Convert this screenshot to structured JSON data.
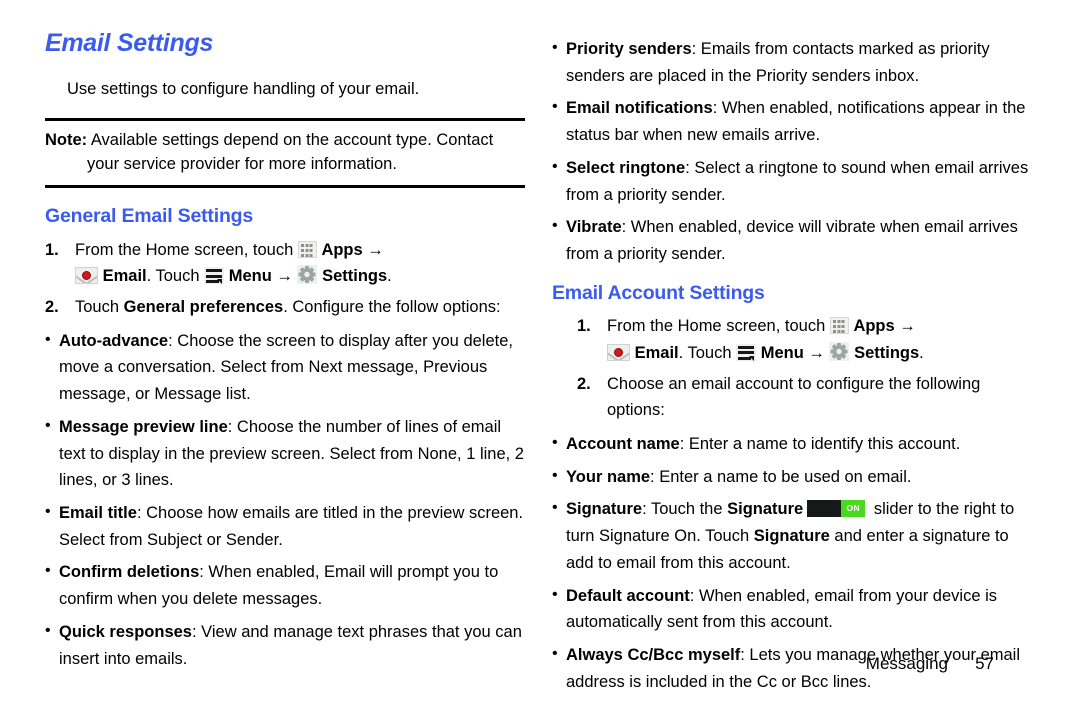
{
  "document": {
    "footer": {
      "section": "Messaging",
      "page_number": "57"
    }
  },
  "left_column": {
    "title": "Email Settings",
    "intro": "Use settings to configure handling of your email.",
    "note": {
      "label": "Note:",
      "line1": " Available settings depend on the account type. Contact",
      "line2": "your service provider for more information."
    },
    "section_heading": "General Email Settings",
    "steps": [
      {
        "number": "1.",
        "text_1": "From the Home screen, touch ",
        "apps_label": "Apps",
        "arrow_1": " → ",
        "email_label": "Email",
        "text_2": ". Touch ",
        "menu_label": "Menu",
        "arrow_2": " → ",
        "settings_label": "Settings",
        "text_3": "."
      },
      {
        "number": "2.",
        "prefix": "Touch ",
        "bold": "General preferences",
        "suffix": ". Configure the follow options:"
      }
    ],
    "bullets": [
      {
        "term": "Auto-advance",
        "desc": ": Choose the screen to display after you delete, move a conversation. Select from Next message, Previous message, or Message list."
      },
      {
        "term": "Message preview line",
        "desc": ": Choose the number of lines of email text to display in the preview screen. Select from None, 1 line, 2 lines, or 3 lines."
      },
      {
        "term": "Email title",
        "desc": ": Choose how emails are titled in the preview screen. Select from Subject or Sender."
      },
      {
        "term": "Confirm deletions",
        "desc": ": When enabled, Email will prompt you to confirm when you delete messages."
      },
      {
        "term": "Quick responses",
        "desc": ": View and manage text phrases that you can insert into emails."
      }
    ]
  },
  "right_column": {
    "continued_bullets": [
      {
        "term": "Priority senders",
        "desc": ": Emails from contacts marked as priority senders are placed in the Priority senders inbox."
      },
      {
        "term": "Email notifications",
        "desc": ": When enabled, notifications appear in the status bar when new emails arrive."
      },
      {
        "term": "Select ringtone",
        "desc": ": Select a ringtone to sound when email arrives from a priority sender."
      },
      {
        "term": "Vibrate",
        "desc": ": When enabled, device will vibrate when email arrives from a priority sender."
      }
    ],
    "section_heading": "Email Account Settings",
    "steps": [
      {
        "number": "1.",
        "text_1": "From the Home screen, touch ",
        "apps_label": "Apps",
        "arrow_1": " → ",
        "email_label": "Email",
        "text_2": ". Touch ",
        "menu_label": "Menu",
        "arrow_2": " → ",
        "settings_label": "Settings",
        "text_3": "."
      },
      {
        "number": "2.",
        "prefix": "Choose an email account to configure the following options:",
        "bold": "",
        "suffix": ""
      }
    ],
    "bullets": [
      {
        "term": "Account name",
        "desc": ": Enter a name to identify this account."
      },
      {
        "term": "Your name",
        "desc": ": Enter a name to be used on email."
      },
      {
        "term": "Default account",
        "desc": ": When enabled, email from your device is automatically sent from this account."
      },
      {
        "term": "Always Cc/Bcc myself",
        "desc": ": Lets you manage whether your email address is included in the Cc or Bcc lines."
      }
    ],
    "signature_bullet": {
      "term": "Signature",
      "part_1": ": Touch the ",
      "bold_1": "Signature",
      "slider_state": "ON",
      "part_2": " slider to the right to turn Signature On. Touch ",
      "bold_2": "Signature",
      "part_3": " and enter a signature to add to email from this account."
    }
  },
  "colors": {
    "heading_blue": "#3a5bee",
    "slider_on_green": "#4bd820",
    "slider_knob": "#17181a",
    "email_icon_red": "#d41818",
    "gear_gray": "#9aa6a3"
  },
  "icons": {
    "apps": "apps-grid-icon",
    "email": "email-envelope-icon",
    "menu": "menu-lines-icon",
    "settings": "gear-icon"
  }
}
